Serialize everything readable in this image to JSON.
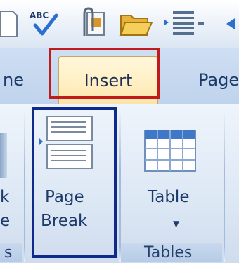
{
  "tabs": {
    "left_partial": "ne",
    "insert": "Insert",
    "right_partial": "Page"
  },
  "ribbon": {
    "left_button_line1": "k",
    "left_button_line2": "e",
    "left_group_partial": "s",
    "page_break": {
      "line1": "Page",
      "line2": "Break"
    },
    "table": {
      "label": "Table"
    },
    "tables_group": "Tables"
  },
  "icons": {
    "qat": [
      "new-document-icon",
      "spelling-abc-icon",
      "attach-file-icon",
      "open-folder-icon",
      "bullets-icon",
      "more-icon"
    ],
    "page_break": "page-break-icon",
    "table": "table-grid-icon",
    "dropdown": "chevron-down-icon"
  },
  "colors": {
    "highlight_red": "#c01a1a",
    "highlight_blue": "#0f2a8a",
    "active_tab": "#ffeec0"
  }
}
